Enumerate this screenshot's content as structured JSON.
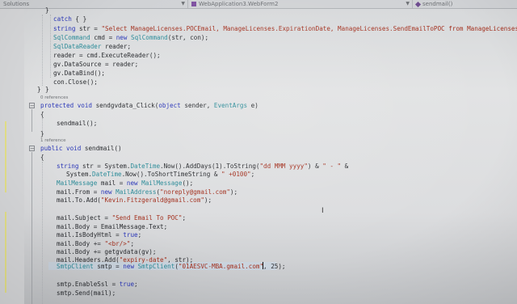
{
  "topbar": {
    "left_label": "Solutions",
    "project": "WebApplication3.WebForm2",
    "member": "sendmail()"
  },
  "codelens": {
    "zero_refs": "0 references",
    "one_ref": "1 reference"
  },
  "code": {
    "l1": "}",
    "l2_kw": "catch",
    "l2_rest": " { }",
    "l3_kw": "string",
    "l3_a": " str = ",
    "l3_str": "\"Select ManageLicenses.POCEmail, ManageLicenses.ExpirationDate, ManageLicenses.SendEmailToPOC from ManageLicenses\"",
    "l3_end": ";",
    "l4_ty": "SqlCommand",
    "l4_a": " cmd = ",
    "l4_kw": "new",
    "l4_ty2": " SqlCommand",
    "l4_end": "(str, con);",
    "l5_ty": "SqlDataReader",
    "l5_a": " reader;",
    "l6": "reader = cmd.ExecuteReader();",
    "l7": "gv.DataSource = reader;",
    "l8": "gv.DataBind();",
    "l9": "con.Close();",
    "l10": "}",
    "l11": "}",
    "l12_kw": "protected void",
    "l12_a": " sendgvdata_Click(",
    "l12_kw2": "object",
    "l12_b": " sender, ",
    "l12_ty": "EventArgs",
    "l12_c": " e)",
    "l13": "{",
    "l14": "sendmail();",
    "l15": "}",
    "l16_kw": "public void",
    "l16_a": " sendmail()",
    "l17": "{",
    "l18_kw": "string",
    "l18_a": " str = System.",
    "l18_ty": "DateTime",
    "l18_b": ".Now().AddDays(1).ToString(",
    "l18_str": "\"dd MMM yyyy\"",
    "l18_c": ") & ",
    "l18_str2": "\" - \"",
    "l18_d": " &",
    "l19_a": "System.",
    "l19_ty": "DateTime",
    "l19_b": ".Now().ToShortTimeString & ",
    "l19_str": "\" +0100\"",
    "l19_end": ";",
    "l20_ty": "MailMessage",
    "l20_a": " mail = ",
    "l20_kw": "new",
    "l20_ty2": " MailMessage",
    "l20_end": "();",
    "l21_a": "mail.From = ",
    "l21_kw": "new",
    "l21_ty": " MailAddress",
    "l21_b": "(",
    "l21_str": "\"noreply@gmail.com\"",
    "l21_end": ");",
    "l22_a": "mail.To.Add(",
    "l22_str": "\"Kevin.Fitzgerald@gmail.com\"",
    "l22_end": ");",
    "l23_a": "mail.Subject = ",
    "l23_str": "\"Send Email To POC\"",
    "l23_end": ";",
    "l24": "mail.Body = EmailMessage.Text;",
    "l25_a": "mail.IsBodyHtml = ",
    "l25_kw": "true",
    "l25_end": ";",
    "l26_a": "mail.Body += ",
    "l26_str": "\"<br/>\"",
    "l26_end": ";",
    "l27": "mail.Body += getgvdata(gv);",
    "l28_a": "mail.Headers.Add(",
    "l28_str": "\"expiry-date\"",
    "l28_end": ", str);",
    "l29_ty": "SmtpClient",
    "l29_a": " smtp = ",
    "l29_kw": "new",
    "l29_ty2": " SmtpClient",
    "l29_b": "(",
    "l29_str": "\"01AESVC-MBA.gmail.com\"",
    "l29_end": ", 25);",
    "l30_a": "smtp.EnableSsl = ",
    "l30_kw": "true",
    "l30_end": ";",
    "l31": "smtp.Send(mail);"
  }
}
